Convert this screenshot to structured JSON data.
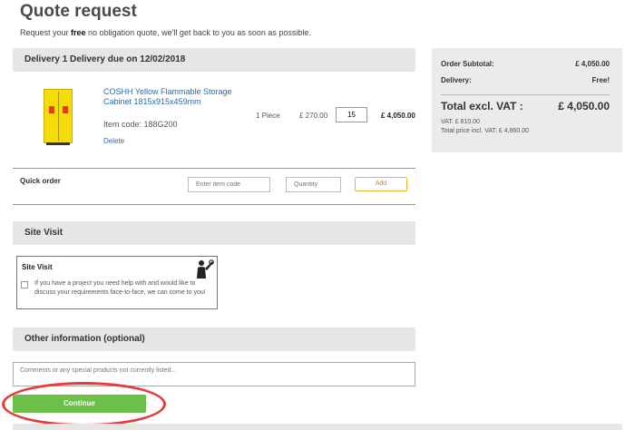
{
  "page": {
    "title": "Quote request",
    "intro_before": "Request your ",
    "intro_bold": "free",
    "intro_after": " no obligation quote, we'll get back to you as soon as possible."
  },
  "delivery": {
    "header": "Delivery 1 Delivery due on 12/02/2018"
  },
  "product": {
    "name": "COSHH Yellow Flammable Storage Cabinet 1815x915x459mm",
    "item_code": "Item code: 188G200",
    "delete_label": "Delete",
    "unit": "1 Piece",
    "price": "£ 270.00",
    "quantity": "15",
    "line_total": "£ 4,050.00"
  },
  "quick_order": {
    "label": "Quick order",
    "item_placeholder": "Enter item code",
    "qty_placeholder": "Quantity",
    "add_label": "Add"
  },
  "site_visit": {
    "header": "Site Visit",
    "box_title": "Site Visit",
    "text": "If you have a project you need help with and would like to discuss your requirements face-to-face, we can come to you!"
  },
  "other_info": {
    "header": "Other information (optional)",
    "placeholder": "Comments or any special products not currently listed..."
  },
  "actions": {
    "continue_label": "Continue"
  },
  "summary": {
    "subtotal_label": "Order Subtotal:",
    "subtotal_value": "£ 4,050.00",
    "delivery_label": "Delivery:",
    "delivery_value": "Free!",
    "total_label": "Total excl. VAT :",
    "total_value": "£ 4,050.00",
    "vat_line": "VAT: £ 810.00",
    "total_incl_line": "Total price incl. VAT: £ 4,860.00"
  },
  "colors": {
    "link": "#2a6ab8",
    "continue": "#6cc04a",
    "add_border": "#f0b429",
    "highlight": "#e23c3c"
  }
}
